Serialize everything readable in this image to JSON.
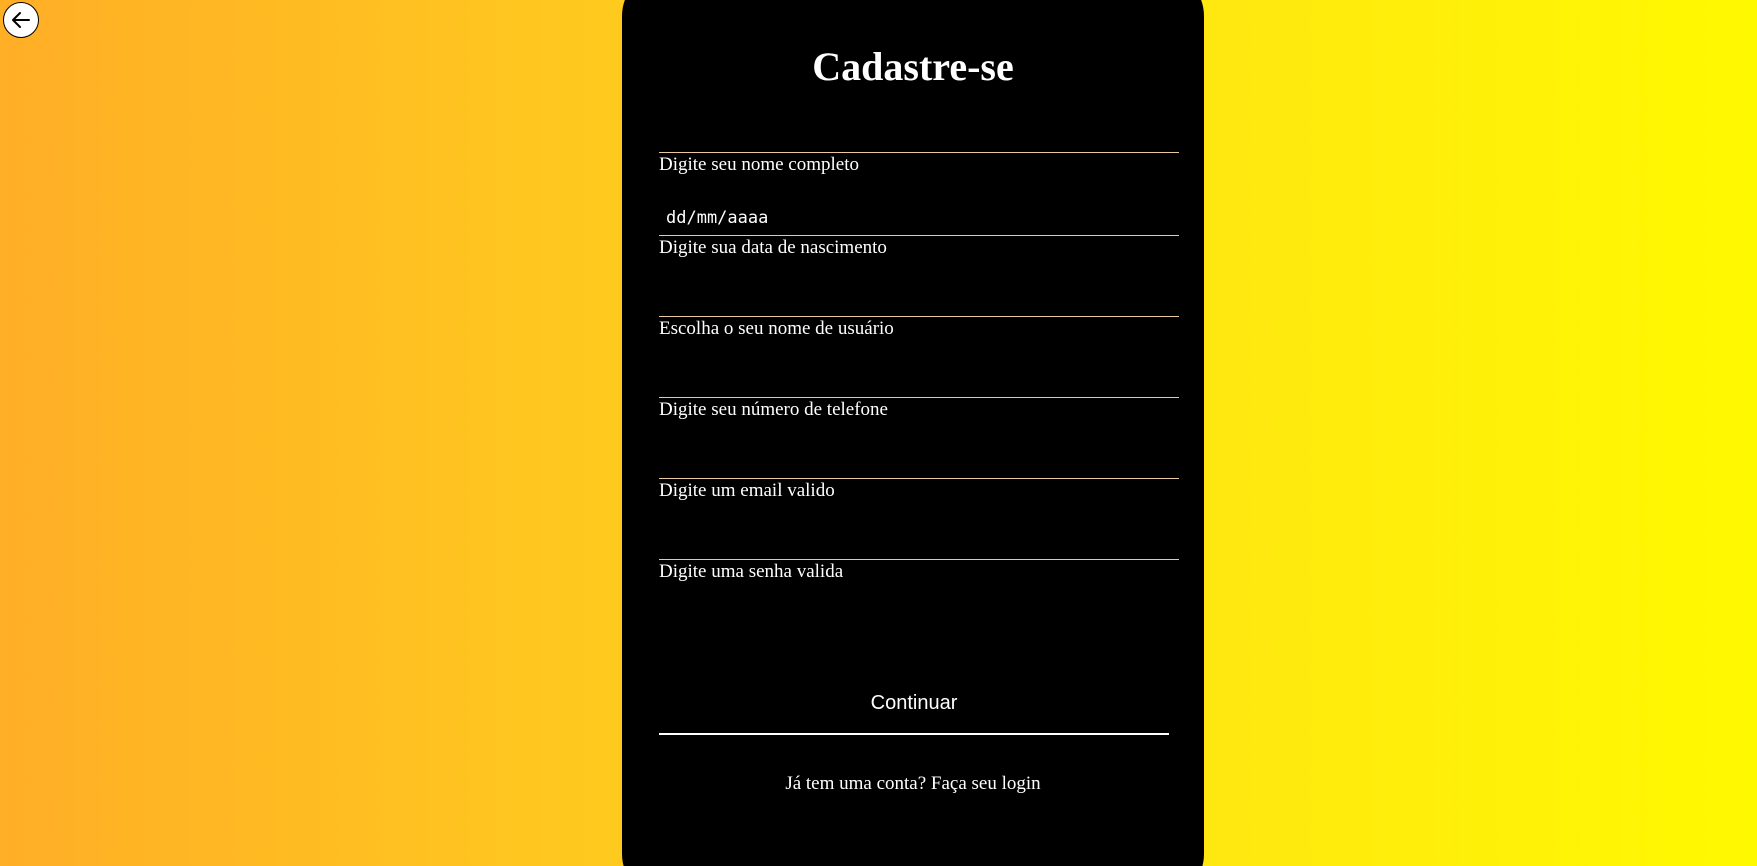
{
  "back": {
    "icon": "arrow-left-icon"
  },
  "form": {
    "title": "Cadastre-se",
    "fields": [
      {
        "label": "Digite seu nome completo",
        "value": "",
        "placeholder": ""
      },
      {
        "label": "Digite sua data de nascimento",
        "value": "",
        "placeholder": "dd/mm/aaaa"
      },
      {
        "label": "Escolha o seu nome de usuário",
        "value": "",
        "placeholder": ""
      },
      {
        "label": "Digite seu número de telefone",
        "value": "",
        "placeholder": ""
      },
      {
        "label": "Digite um email valido",
        "value": "",
        "placeholder": ""
      },
      {
        "label": "Digite uma senha valida",
        "value": "",
        "placeholder": ""
      }
    ],
    "continue_label": "Continuar",
    "login_text": "Já tem uma conta? Faça seu login"
  },
  "colors": {
    "card_background": "#000000",
    "gradient_start": "#ffae26",
    "gradient_end": "#fff900",
    "underline": "#e9c9a0",
    "text": "#ffffff"
  }
}
